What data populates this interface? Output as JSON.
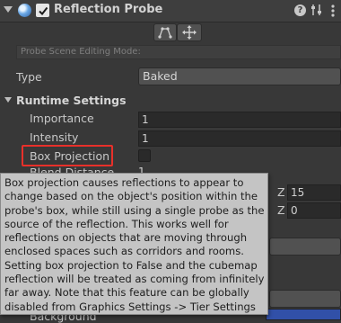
{
  "component": {
    "title": "Reflection Probe",
    "enabled": true
  },
  "scene_editing": {
    "mode_label": "Probe Scene Editing Mode:"
  },
  "type": {
    "label": "Type",
    "value": "Baked"
  },
  "runtime_settings": {
    "header": "Runtime Settings",
    "importance_label": "Importance",
    "importance_value": "1",
    "intensity_label": "Intensity",
    "intensity_value": "1",
    "box_projection_label": "Box Projection",
    "box_projection_checked": false,
    "blend_distance_label": "Blend Distance",
    "blend_distance_value": "1",
    "box_size_z_label": "Z",
    "box_size_z_value": "15",
    "box_offset_z_label": "Z",
    "box_offset_z_value": "0"
  },
  "cubemap_capture": {
    "background_label": "Background"
  },
  "tooltip": {
    "text": "Box projection causes reflections to appear to change based on the object's position within the probe's box, while still using a single probe as the source of the reflection. This works well for reflections on objects that are moving through enclosed spaces such as corridors and rooms. Setting box projection to False and the cubemap reflection will be treated as coming from infinitely far away. Note that this feature can be globally disabled from Graphics Settings -> Tier Settings"
  },
  "colors": {
    "highlight": "#e8302a",
    "tooltip_bg": "#c4c4c4",
    "background_swatch": "#3150a8"
  },
  "icons": {
    "foldout": "triangle-down-icon",
    "component": "reflection-probe-icon",
    "help": "question-icon",
    "presets": "sliders-icon",
    "menu": "kebab-icon",
    "edit_bounds": "bounds-edit-icon",
    "edit_origin": "move-icon"
  }
}
